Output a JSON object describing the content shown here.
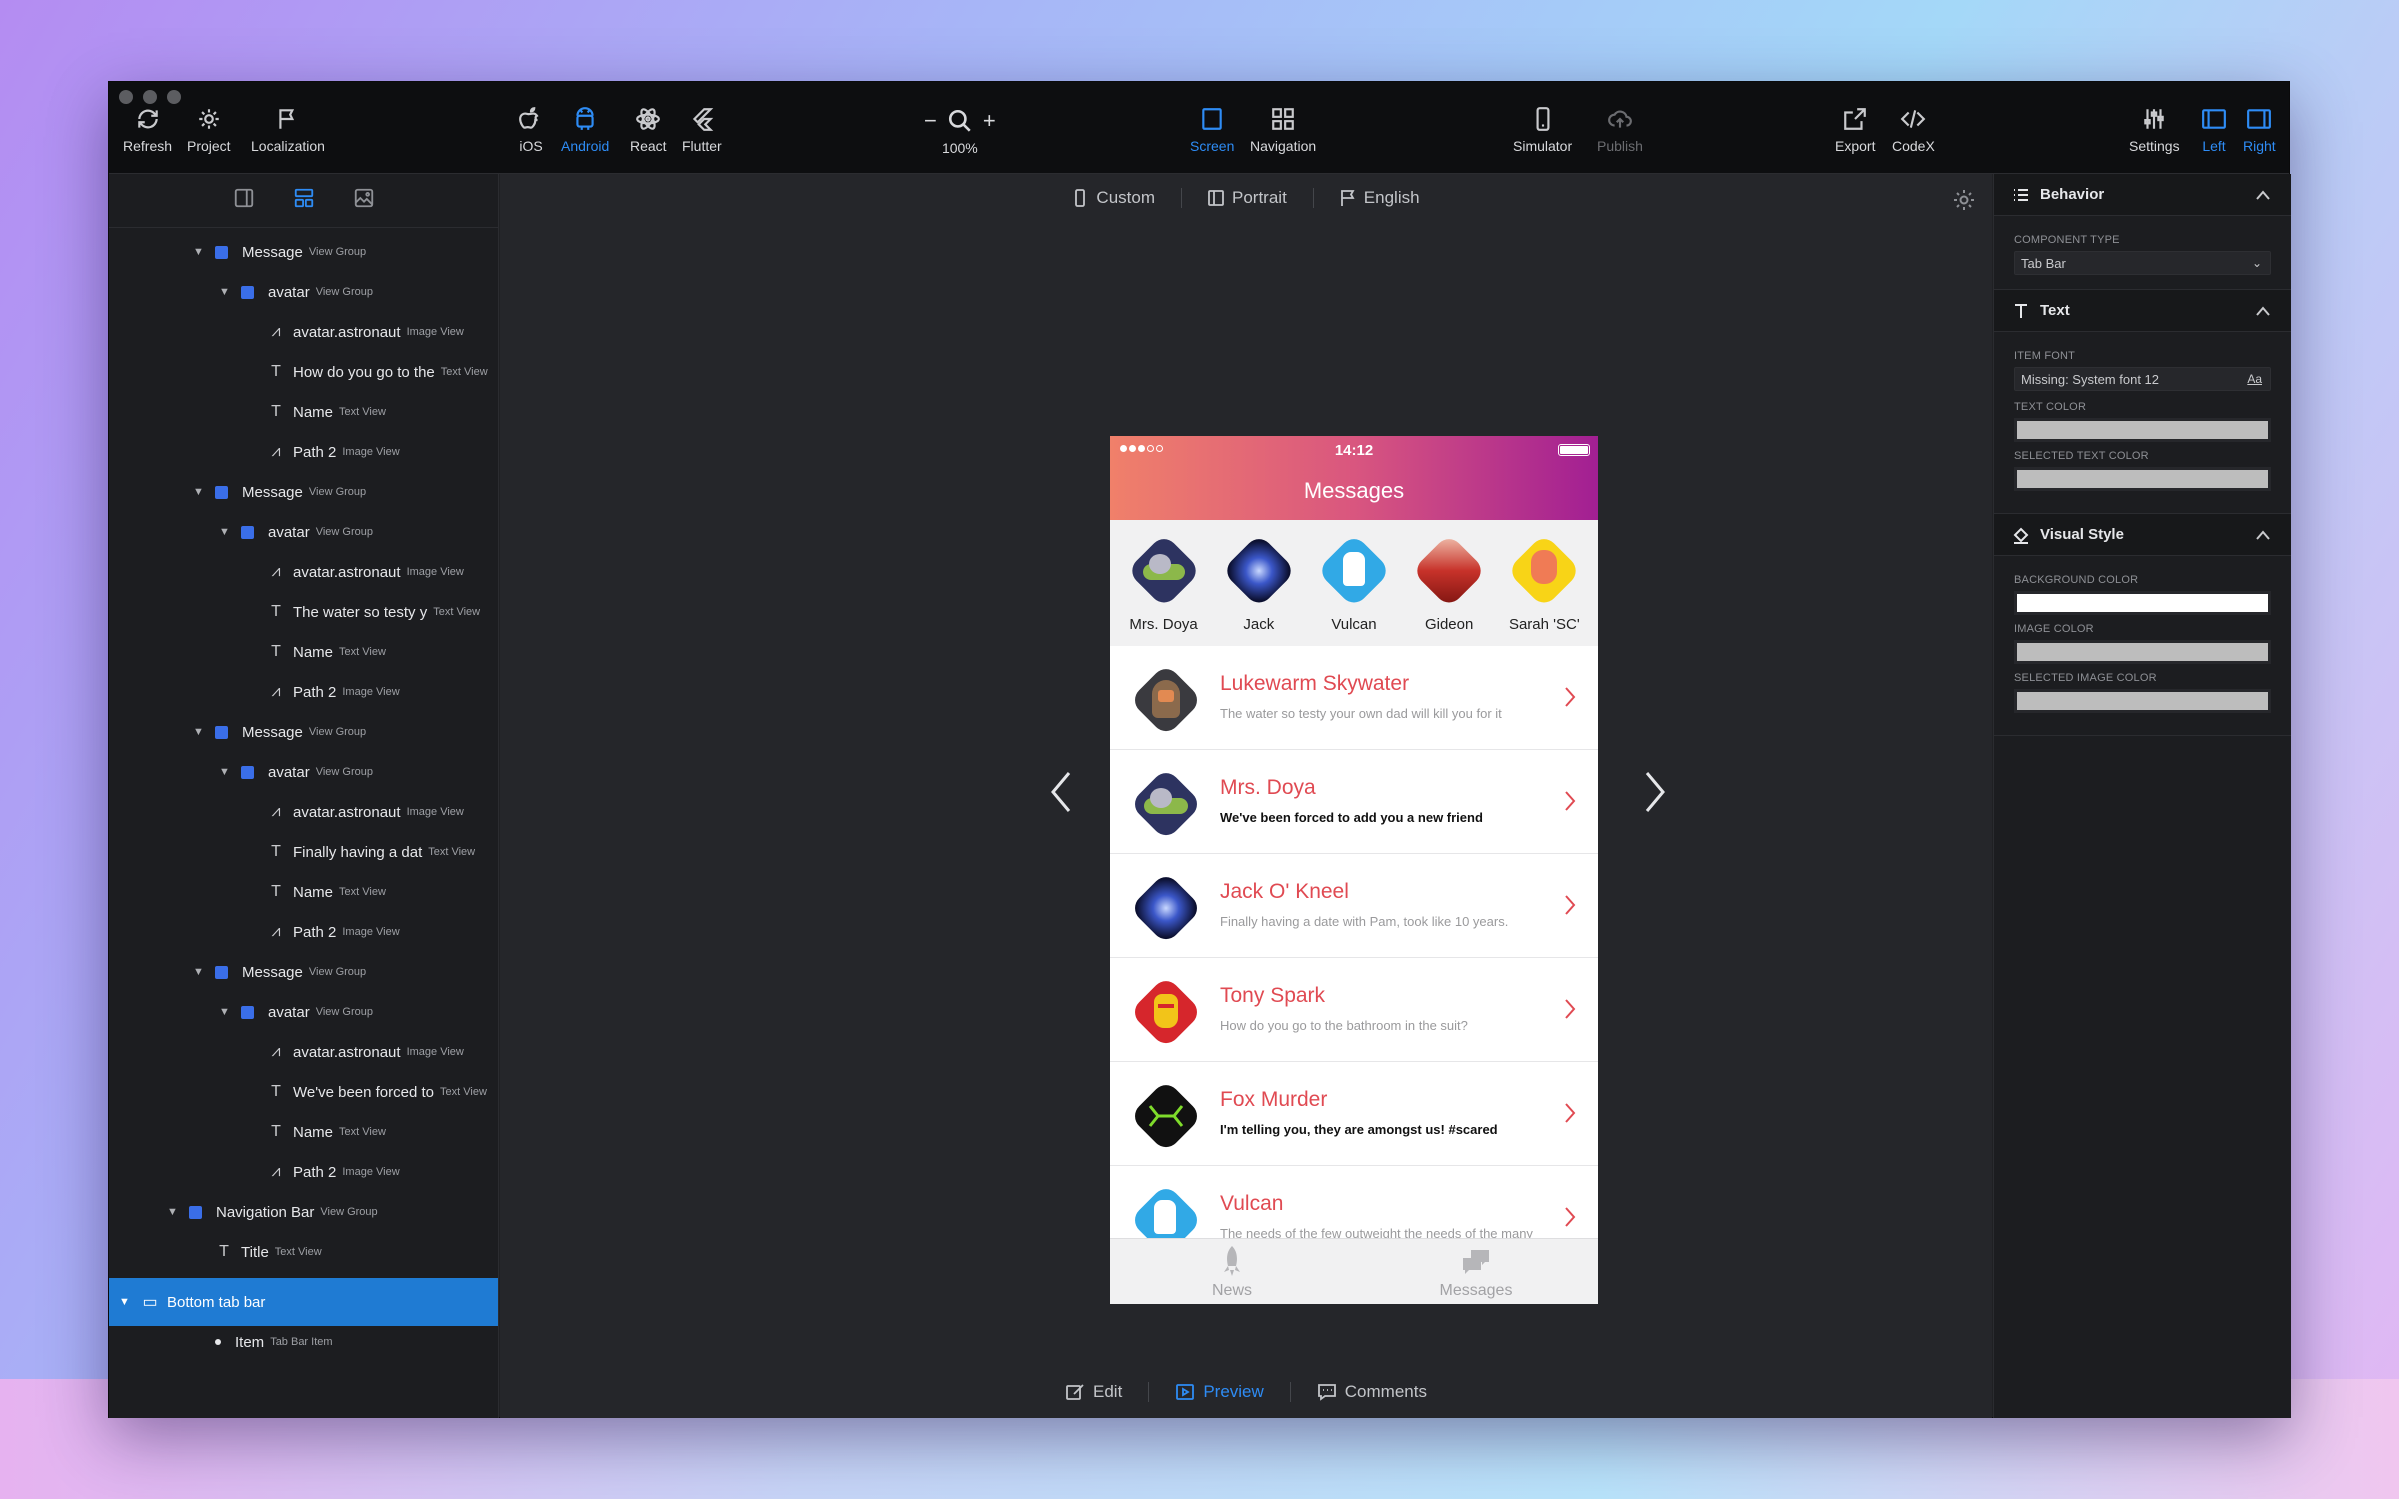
{
  "toolbar": {
    "refresh": "Refresh",
    "project": "Project",
    "localization": "Localization",
    "ios": "iOS",
    "android": "Android",
    "react": "React",
    "flutter": "Flutter",
    "zoom_minus": "−",
    "zoom_plus": "+",
    "zoom": "100%",
    "screen": "Screen",
    "navigation": "Navigation",
    "simulator": "Simulator",
    "publish": "Publish",
    "export": "Export",
    "codex": "CodeX",
    "settings": "Settings",
    "left": "Left",
    "right": "Right"
  },
  "layers": [
    {
      "name": "Message",
      "type": "View Group"
    },
    {
      "name": "avatar",
      "type": "View Group"
    },
    {
      "name": "avatar.astronaut",
      "type": "Image View"
    },
    {
      "name": "How do you go to the",
      "type": "Text View"
    },
    {
      "name": "Name",
      "type": "Text View"
    },
    {
      "name": "Path 2",
      "type": "Image View"
    },
    {
      "name": "Message",
      "type": "View Group"
    },
    {
      "name": "avatar",
      "type": "View Group"
    },
    {
      "name": "avatar.astronaut",
      "type": "Image View"
    },
    {
      "name": "The water so testy y",
      "type": "Text View"
    },
    {
      "name": "Name",
      "type": "Text View"
    },
    {
      "name": "Path 2",
      "type": "Image View"
    },
    {
      "name": "Message",
      "type": "View Group"
    },
    {
      "name": "avatar",
      "type": "View Group"
    },
    {
      "name": "avatar.astronaut",
      "type": "Image View"
    },
    {
      "name": "Finally having a dat",
      "type": "Text View"
    },
    {
      "name": "Name",
      "type": "Text View"
    },
    {
      "name": "Path 2",
      "type": "Image View"
    },
    {
      "name": "Message",
      "type": "View Group"
    },
    {
      "name": "avatar",
      "type": "View Group"
    },
    {
      "name": "avatar.astronaut",
      "type": "Image View"
    },
    {
      "name": "We've been forced to",
      "type": "Text View"
    },
    {
      "name": "Name",
      "type": "Text View"
    },
    {
      "name": "Path 2",
      "type": "Image View"
    },
    {
      "name": "Navigation Bar",
      "type": "View Group"
    },
    {
      "name": "Title",
      "type": "Text View"
    },
    {
      "name": "Bottom tab bar",
      "type": ""
    },
    {
      "name": "Item",
      "type": "Tab Bar Item"
    }
  ],
  "canvas": {
    "device": "Custom",
    "orientation": "Portrait",
    "language": "English",
    "edit": "Edit",
    "preview": "Preview",
    "comments": "Comments"
  },
  "phone": {
    "time": "14:12",
    "title": "Messages",
    "stories": [
      "Mrs. Doya",
      "Jack",
      "Vulcan",
      "Gideon",
      "Sarah 'SC'"
    ],
    "messages": [
      {
        "name": "Lukewarm Skywater",
        "text": "The water so testy your own dad will kill you for it"
      },
      {
        "name": "Mrs. Doya",
        "text": "We've been forced to add you a new friend"
      },
      {
        "name": "Jack O' Kneel",
        "text": "Finally having a date with Pam, took like 10 years."
      },
      {
        "name": "Tony Spark",
        "text": "How do you go to the bathroom in the suit?"
      },
      {
        "name": "Fox Murder",
        "text": "I'm telling you, they are amongst us! #scared"
      },
      {
        "name": "Vulcan",
        "text": "The needs of the few outweight the needs of the many"
      }
    ],
    "tabs": [
      "News",
      "Messages"
    ]
  },
  "inspector": {
    "behavior": "Behavior",
    "component_type_label": "COMPONENT TYPE",
    "component_type": "Tab Bar",
    "text": "Text",
    "item_font_label": "ITEM FONT",
    "item_font": "Missing: System font 12",
    "font_btn": "Aa",
    "text_color_label": "TEXT COLOR",
    "selected_text_color_label": "SELECTED TEXT COLOR",
    "visual_style": "Visual Style",
    "background_color_label": "BACKGROUND COLOR",
    "image_color_label": "IMAGE COLOR",
    "selected_image_color_label": "SELECTED IMAGE COLOR",
    "text_color": "#bdbdbd",
    "selected_text_color": "#bdbdbd",
    "background_color": "#ffffff",
    "image_color": "#bdbdbd",
    "selected_image_color": "#bdbdbd"
  },
  "colors": {
    "accent": "#2e8cf5",
    "selection": "#1f7bd3",
    "brand_red": "#e04a52"
  }
}
